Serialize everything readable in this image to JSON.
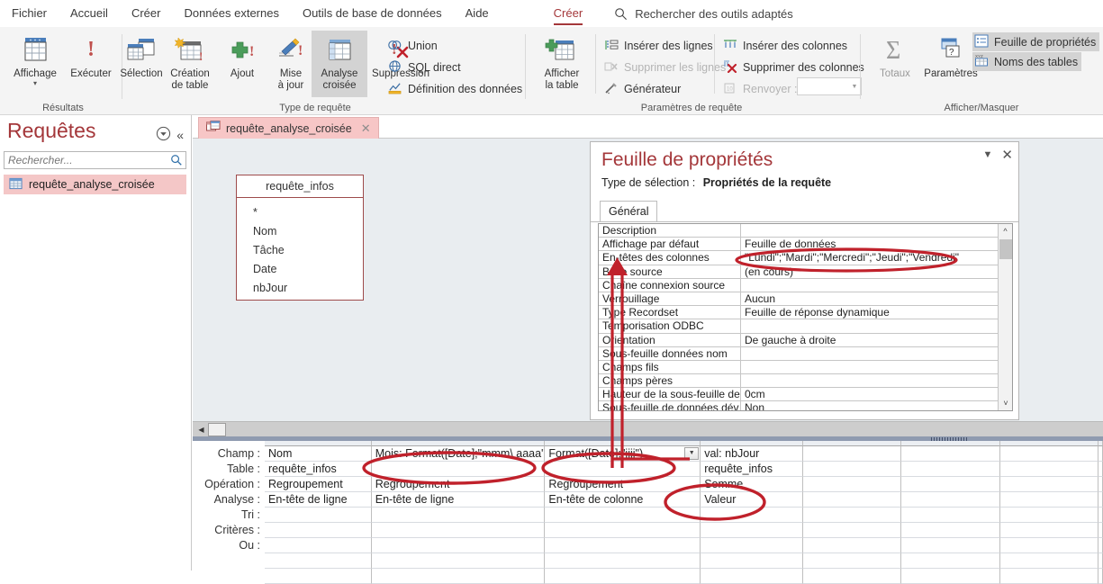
{
  "menu": {
    "items": [
      {
        "label": "Fichier"
      },
      {
        "label": "Accueil"
      },
      {
        "label": "Créer"
      },
      {
        "label": "Données externes"
      },
      {
        "label": "Outils de base de données"
      },
      {
        "label": "Aide"
      },
      {
        "label": "Créer"
      }
    ],
    "active_index": 6,
    "search_placeholder": "Rechercher des outils adaptés"
  },
  "ribbon": {
    "groups": [
      {
        "title": "Résultats"
      },
      {
        "title": "Type de requête"
      },
      {
        "title": "Paramètres de requête"
      },
      {
        "title": "Afficher/Masquer"
      }
    ],
    "results": {
      "affichage": "Affichage",
      "executer": "Exécuter"
    },
    "query_type": {
      "selection": "Sélection",
      "creation_table_l1": "Création",
      "creation_table_l2": "de table",
      "ajout": "Ajout",
      "mise_a_jour_l1": "Mise",
      "mise_a_jour_l2": "à jour",
      "analyse_croisee_l1": "Analyse",
      "analyse_croisee_l2": "croisée",
      "suppression": "Suppression",
      "union": "Union",
      "sql_direct": "SQL direct",
      "definition_donnees": "Définition des données"
    },
    "query_params": {
      "afficher_table_l1": "Afficher",
      "afficher_table_l2": "la table",
      "inserer_lignes": "Insérer des lignes",
      "supprimer_lignes": "Supprimer les lignes",
      "generateur": "Générateur",
      "inserer_colonnes": "Insérer des colonnes",
      "supprimer_colonnes": "Supprimer des colonnes",
      "renvoyer": "Renvoyer :",
      "renvoyer_value": ""
    },
    "show_hide": {
      "totaux": "Totaux",
      "parametres": "Paramètres",
      "feuille_proprietes": "Feuille de propriétés",
      "noms_tables": "Noms des tables"
    }
  },
  "navpane": {
    "title": "Requêtes",
    "search_placeholder": "Rechercher...",
    "items": [
      {
        "label": "requête_analyse_croisée",
        "selected": true
      }
    ]
  },
  "document": {
    "tab_label": "requête_analyse_croisée",
    "table_box": {
      "title": "requête_infos",
      "fields": [
        "*",
        "Nom",
        "Tâche",
        "Date",
        "nbJour"
      ]
    }
  },
  "property_sheet": {
    "title": "Feuille de propriétés",
    "selection_type_label": "Type de sélection :",
    "selection_type_value": "Propriétés de la requête",
    "tabs": [
      "Général"
    ],
    "active_tab": "Général",
    "rows": [
      {
        "name": "Description",
        "value": ""
      },
      {
        "name": "Affichage par défaut",
        "value": "Feuille de données"
      },
      {
        "name": "En-têtes des colonnes",
        "value": "\"Lundi\";\"Mardi\";\"Mercredi\";\"Jeudi\";\"Vendredi\""
      },
      {
        "name": "Base source",
        "value": "(en cours)"
      },
      {
        "name": "Chaîne connexion source",
        "value": ""
      },
      {
        "name": "Verrouillage",
        "value": "Aucun"
      },
      {
        "name": "Type Recordset",
        "value": "Feuille de réponse dynamique"
      },
      {
        "name": "Temporisation ODBC",
        "value": ""
      },
      {
        "name": "Orientation",
        "value": "De gauche à droite"
      },
      {
        "name": "Sous-feuille données nom",
        "value": ""
      },
      {
        "name": "Champs fils",
        "value": ""
      },
      {
        "name": "Champs pères",
        "value": ""
      },
      {
        "name": "Hauteur de la sous-feuille de",
        "value": "0cm"
      },
      {
        "name": "Sous-feuille de données dév",
        "value": "Non"
      }
    ]
  },
  "query_grid": {
    "row_labels": [
      "Champ :",
      "Table :",
      "Opération :",
      "Analyse :",
      "Tri :",
      "Critères :",
      "Ou :"
    ],
    "columns": [
      {
        "champ": "Nom",
        "table": "requête_infos",
        "operation": "Regroupement",
        "analyse": "En-tête de ligne",
        "tri": "",
        "criteres": "",
        "ou": "",
        "has_combo": false
      },
      {
        "champ": "Mois: Format([Date];\"mmm\\ aaaa\")",
        "table": "",
        "operation": "Regroupement",
        "analyse": "En-tête de ligne",
        "tri": "",
        "criteres": "",
        "ou": "",
        "has_combo": false
      },
      {
        "champ": "Format([Date];\"jjjj\")",
        "table": "",
        "operation": "Regroupement",
        "analyse": "En-tête de colonne",
        "tri": "",
        "criteres": "",
        "ou": "",
        "has_combo": true
      },
      {
        "champ": "val: nbJour",
        "table": "requête_infos",
        "operation": "Somme",
        "analyse": "Valeur",
        "tri": "",
        "criteres": "",
        "ou": "",
        "has_combo": false
      },
      {
        "champ": "",
        "table": "",
        "operation": "",
        "analyse": "",
        "tri": "",
        "criteres": "",
        "ou": "",
        "has_combo": false
      },
      {
        "champ": "",
        "table": "",
        "operation": "",
        "analyse": "",
        "tri": "",
        "criteres": "",
        "ou": "",
        "has_combo": false
      },
      {
        "champ": "",
        "table": "",
        "operation": "",
        "analyse": "",
        "tri": "",
        "criteres": "",
        "ou": "",
        "has_combo": false
      },
      {
        "champ": "",
        "table": "",
        "operation": "",
        "analyse": "",
        "tri": "",
        "criteres": "",
        "ou": "",
        "has_combo": false
      }
    ]
  },
  "annotations": {
    "highlight_color": "#c0212b",
    "items": [
      {
        "name": "column-headings-property-highlight"
      },
      {
        "name": "month-expression-highlight"
      },
      {
        "name": "day-format-expression-highlight"
      },
      {
        "name": "sum-value-highlight"
      },
      {
        "name": "connector-arrow"
      }
    ]
  },
  "colors": {
    "accent_red": "#a4373a",
    "tab_pink": "#f7c6c6",
    "nav_select": "#f4c7c7",
    "ribbon_bg": "#f4f4f4",
    "workspace_bg": "#e9edf0",
    "annotation_red": "#c0212b"
  }
}
